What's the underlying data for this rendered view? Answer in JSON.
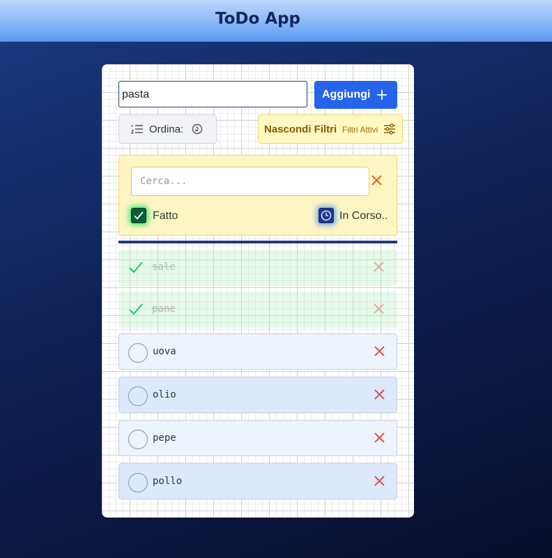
{
  "header": {
    "title": "ToDo App"
  },
  "new_task": {
    "value": "pasta",
    "add_label": "Aggiungi"
  },
  "sort": {
    "label": "Ordina:"
  },
  "filter_toggle": {
    "label": "Nascondi Filtri",
    "badge": "Filtri Attivi"
  },
  "filters": {
    "search_placeholder": "Cerca...",
    "search_value": "",
    "done": {
      "label": "Fatto",
      "checked": true
    },
    "in_progress": {
      "label": "In Corso..",
      "checked": true
    }
  },
  "tasks": [
    {
      "text": "sale",
      "done": true
    },
    {
      "text": "pane",
      "done": true
    },
    {
      "text": "uova",
      "done": false
    },
    {
      "text": "olio",
      "done": false
    },
    {
      "text": "pepe",
      "done": false
    },
    {
      "text": "pollo",
      "done": false
    }
  ],
  "icons": {
    "add": "plus-icon",
    "sort": "list-ordered-icon",
    "sort_direction": "circle-arrow-icon",
    "filter": "sliders-icon",
    "clear": "close-icon",
    "done": "check-icon",
    "in_progress": "clock-icon",
    "task_delete": "close-icon"
  },
  "colors": {
    "primary": "#2563eb",
    "done_accent": "#22c55e",
    "delete": "#e05050",
    "filter_bg": "#fef6c2",
    "header_text": "#15275e"
  }
}
